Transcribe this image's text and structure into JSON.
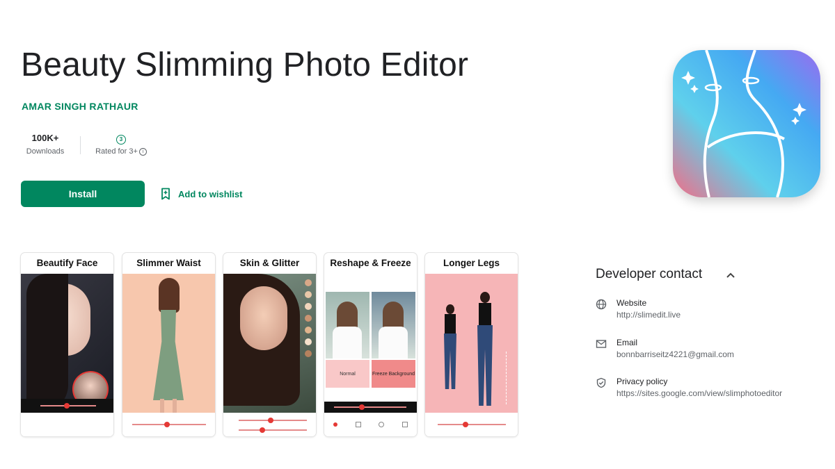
{
  "app": {
    "title": "Beauty Slimming Photo Editor",
    "developer": "AMAR SINGH RATHAUR"
  },
  "stats": {
    "downloads_value": "100K+",
    "downloads_label": "Downloads",
    "rating_badge": "3",
    "rating_label": "Rated for 3+"
  },
  "actions": {
    "install_label": "Install",
    "wishlist_label": "Add to wishlist"
  },
  "screenshots": [
    {
      "caption": "Beautify Face"
    },
    {
      "caption": "Slimmer Waist"
    },
    {
      "caption": "Skin & Glitter"
    },
    {
      "caption": "Reshape & Freeze",
      "left_panel_label": "Normal",
      "right_panel_label": "Freeze Background"
    },
    {
      "caption": "Longer Legs"
    }
  ],
  "developer_contact": {
    "heading": "Developer contact",
    "website_label": "Website",
    "website_value": "http://slimedit.live",
    "email_label": "Email",
    "email_value": "bonnbarriseitz4221@gmail.com",
    "privacy_label": "Privacy policy",
    "privacy_value": "https://sites.google.com/view/slimphotoeditor"
  },
  "colors": {
    "brand_green": "#01875f",
    "text_primary": "#202124",
    "text_secondary": "#5f6368"
  },
  "icons": [
    "info-icon",
    "bookmark-icon",
    "app-icon",
    "chevron-up-icon",
    "globe-icon",
    "mail-icon",
    "shield-icon"
  ]
}
